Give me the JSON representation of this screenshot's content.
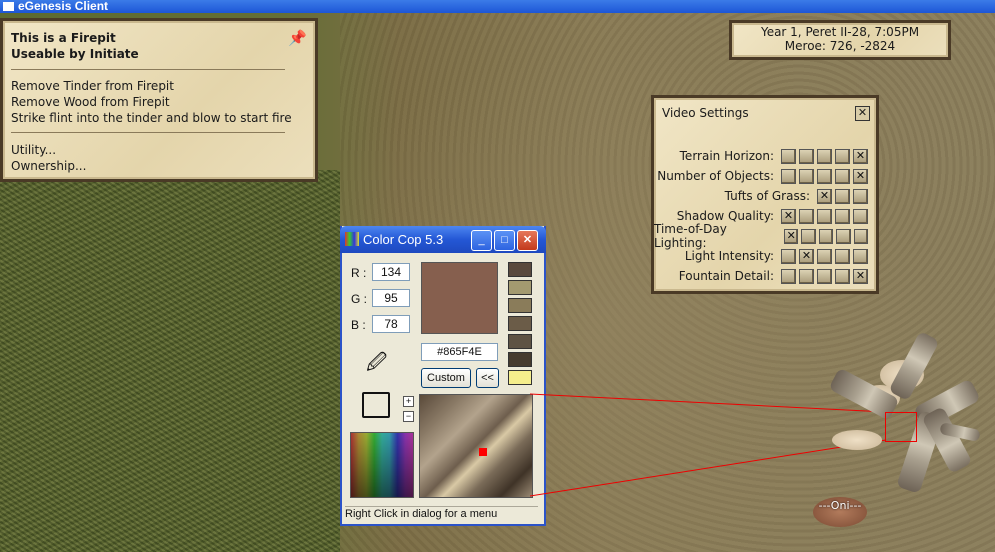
{
  "window": {
    "title": "eGenesis Client"
  },
  "firepit_menu": {
    "title_line1": "This is a Firepit",
    "title_line2": "Useable by Initiate",
    "actions": [
      "Remove Tinder from Firepit",
      "Remove Wood from Firepit",
      "Strike flint into the tinder and blow to start fire"
    ],
    "links": [
      "Utility...",
      "Ownership..."
    ]
  },
  "clock": {
    "date_time": "Year 1, Peret II-28, 7:05PM",
    "location": "Meroe: 726, -2824"
  },
  "video_settings": {
    "title": "Video Settings",
    "close_glyph": "✕",
    "rows": [
      {
        "label": "Terrain Horizon:",
        "boxes": [
          "",
          "",
          "",
          "",
          "✕"
        ]
      },
      {
        "label": "Number of Objects:",
        "boxes": [
          "",
          "",
          "",
          "",
          "✕"
        ]
      },
      {
        "label": "Tufts of Grass:",
        "boxes": [
          "✕",
          "",
          ""
        ]
      },
      {
        "label": "Shadow Quality:",
        "boxes": [
          "✕",
          "",
          "",
          "",
          ""
        ]
      },
      {
        "label": "Time-of-Day Lighting:",
        "boxes": [
          "✕",
          "",
          "",
          "",
          ""
        ]
      },
      {
        "label": "Light Intensity:",
        "boxes": [
          "",
          "✕",
          "",
          "",
          ""
        ]
      },
      {
        "label": "Fountain Detail:",
        "boxes": [
          "",
          "",
          "",
          "",
          "✕"
        ]
      }
    ]
  },
  "color_cop": {
    "title": "Color Cop 5.3",
    "r_label": "R :",
    "g_label": "G :",
    "b_label": "B :",
    "r": "134",
    "g": "95",
    "b": "78",
    "hex": "#865F4E",
    "custom_label": "Custom",
    "collapse_label": "<<",
    "zoom_in": "+",
    "zoom_out": "−",
    "status": "Right Click in dialog for a menu",
    "history_colors": [
      "#5a4a3e",
      "#a39a70",
      "#8a7c5a",
      "#6b5c48",
      "#5e5344",
      "#463b2e",
      "#f5ee8c"
    ],
    "current_color": "#865F4E"
  },
  "player": {
    "name": "---Oni---"
  }
}
